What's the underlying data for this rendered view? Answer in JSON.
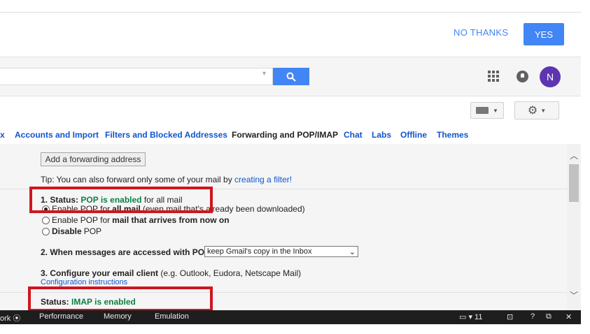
{
  "banner": {
    "no_thanks": "NO THANKS",
    "yes": "YES"
  },
  "header": {
    "avatar_letter": "N"
  },
  "tabs": [
    {
      "label": "x"
    },
    {
      "label": "Accounts and Import"
    },
    {
      "label": "Filters and Blocked Addresses"
    },
    {
      "label": "Forwarding and POP/IMAP"
    },
    {
      "label": "Chat"
    },
    {
      "label": "Labs"
    },
    {
      "label": "Offline"
    },
    {
      "label": "Themes"
    }
  ],
  "forwarding": {
    "add_button": "Add a forwarding address",
    "tip_prefix": "Tip: You can also forward only some of your mail by ",
    "tip_link": "creating a filter!"
  },
  "pop": {
    "status_prefix": "1. Status: ",
    "status_value": "POP is enabled",
    "status_suffix": " for all mail",
    "option_all_prefix": "Enable POP for ",
    "option_all_bold": "all mail",
    "option_all_suffix": " (even mail that's already been downloaded)",
    "option_now_prefix": "Enable POP for ",
    "option_now_bold": "mail that arrives from now on",
    "option_disable_bold": "Disable",
    "option_disable_suffix": " POP",
    "access_label": "2. When messages are accessed with POP",
    "access_select": "keep Gmail's copy in the Inbox",
    "config_label": "3. Configure your email client",
    "config_hint": " (e.g. Outlook, Eudora, Netscape Mail)",
    "config_link": "Configuration instructions"
  },
  "imap": {
    "status_prefix": "Status: ",
    "status_value": "IMAP is enabled"
  },
  "devtools": {
    "tabs": [
      "ork",
      "Performance",
      "Memory",
      "Emulation"
    ],
    "count": "11",
    "help": "?"
  },
  "colors": {
    "accent": "#4285f4",
    "status_green": "#0b8043",
    "highlight_red": "#d0161e",
    "avatar": "#5e35b1"
  }
}
